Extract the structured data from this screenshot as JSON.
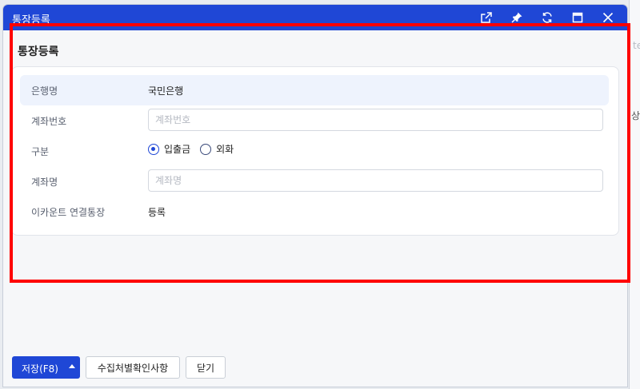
{
  "window": {
    "title": "통장등록",
    "icons": [
      "external-link-icon",
      "pin-icon",
      "refresh-icon",
      "maximize-icon",
      "close-icon"
    ]
  },
  "form": {
    "title": "통장등록",
    "bank_label": "은행명",
    "bank_value": "국민은행",
    "account_number_label": "계좌번호",
    "account_number_placeholder": "계좌번호",
    "account_number_value": "",
    "type_label": "구분",
    "type_options": [
      {
        "label": "입출금",
        "selected": true
      },
      {
        "label": "외화",
        "selected": false
      }
    ],
    "account_name_label": "계좌명",
    "account_name_placeholder": "계좌명",
    "account_name_value": "",
    "ecount_label": "이카운트 연결통장",
    "ecount_value": "등록"
  },
  "footer": {
    "save_label": "저장(F8)",
    "collect_label": "수집처별확인사항",
    "close_label": "닫기"
  },
  "background": {
    "right_text_1": "te",
    "right_text_2": "상"
  },
  "colors": {
    "titlebar": "#1f47d6",
    "highlight": "#ff0000",
    "row_highlight": "#eef3fd"
  }
}
